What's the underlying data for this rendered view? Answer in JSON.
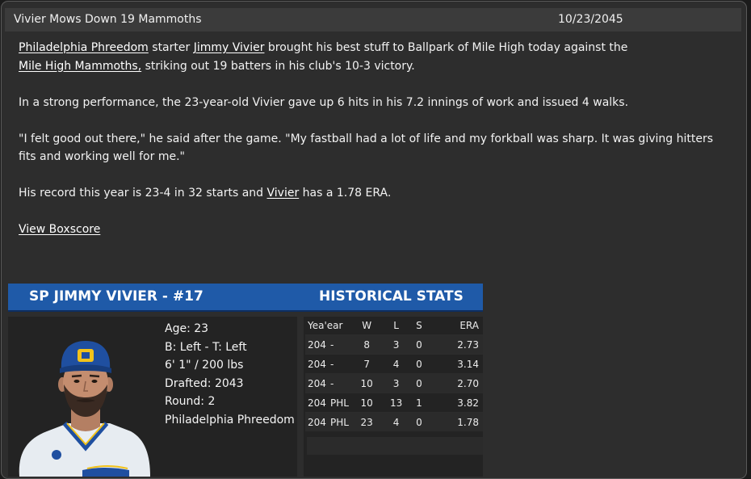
{
  "header": {
    "title": "Vivier Mows Down 19 Mammoths",
    "date": "10/23/2045"
  },
  "story": {
    "p1": {
      "team": "Philadelphia Phreedom",
      "t1": " starter ",
      "player": "Jimmy Vivier",
      "t2": " brought his best stuff to Ballpark of Mile High today against the ",
      "opponent": "Mile High Mammoths,",
      "t3": " striking out 19 batters in his club's 10-3 victory."
    },
    "p2": "In a strong performance, the 23-year-old Vivier gave up 6 hits in his 7.2 innings of work and issued 4 walks.",
    "p3": "\"I felt good out there,\" he said after the game. \"My fastball had a lot of life and my forkball was sharp. It was giving hitters fits and working well for me.\"",
    "p4": {
      "t1": "His record this year is 23-4 in 32 starts and ",
      "player": "Vivier",
      "t2": " has a 1.78 ERA."
    },
    "boxscore_link": "View Boxscore"
  },
  "card": {
    "name": "SP JIMMY VIVIER - #17",
    "historical_title": "HISTORICAL STATS",
    "bio": {
      "age": "Age: 23",
      "bats_throws": "B: Left - T: Left",
      "height_weight": "6' 1\" / 200 lbs",
      "drafted": "Drafted: 2043",
      "round": "Round: 2",
      "team": "Philadelphia Phreedom"
    }
  },
  "stats": {
    "headers": {
      "year": "Yea'ear",
      "w": "W",
      "l": "L",
      "s": "S",
      "era": "ERA"
    },
    "rows": [
      {
        "year": "204",
        "team": "-",
        "w": "8",
        "l": "3",
        "s": "0",
        "era": "2.73"
      },
      {
        "year": "204",
        "team": "-",
        "w": "7",
        "l": "4",
        "s": "0",
        "era": "3.14"
      },
      {
        "year": "204",
        "team": "-",
        "w": "10",
        "l": "3",
        "s": "0",
        "era": "2.70"
      },
      {
        "year": "204",
        "team": "PHL",
        "w": "10",
        "l": "13",
        "s": "1",
        "era": "3.82"
      },
      {
        "year": "204",
        "team": "PHL",
        "w": "23",
        "l": "4",
        "s": "0",
        "era": "1.78"
      }
    ]
  },
  "colors": {
    "header_blue": "#1f5aa8",
    "panel": "#2d2d2d",
    "cap_blue": "#1f4fa0",
    "cap_logo": "#f2c21a"
  },
  "icons": {
    "photo": "player-portrait"
  }
}
